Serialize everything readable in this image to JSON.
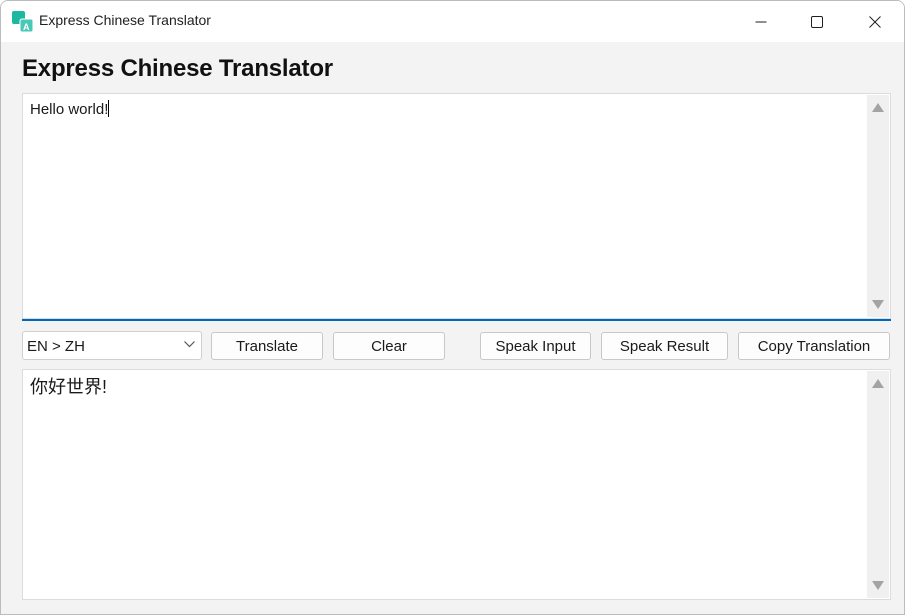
{
  "window": {
    "title": "Express Chinese Translator",
    "minimize_icon": "minimize-icon",
    "maximize_icon": "maximize-icon",
    "close_icon": "close-icon"
  },
  "heading": "Express Chinese Translator",
  "input": {
    "value": "Hello world!"
  },
  "controls": {
    "language_select": "EN > ZH",
    "translate_label": "Translate",
    "clear_label": "Clear",
    "speak_input_label": "Speak Input",
    "speak_result_label": "Speak Result",
    "copy_translation_label": "Copy Translation"
  },
  "output": {
    "value": "你好世界!"
  },
  "colors": {
    "focus_accent": "#0067c0",
    "icon_teal": "#1db8a0"
  }
}
